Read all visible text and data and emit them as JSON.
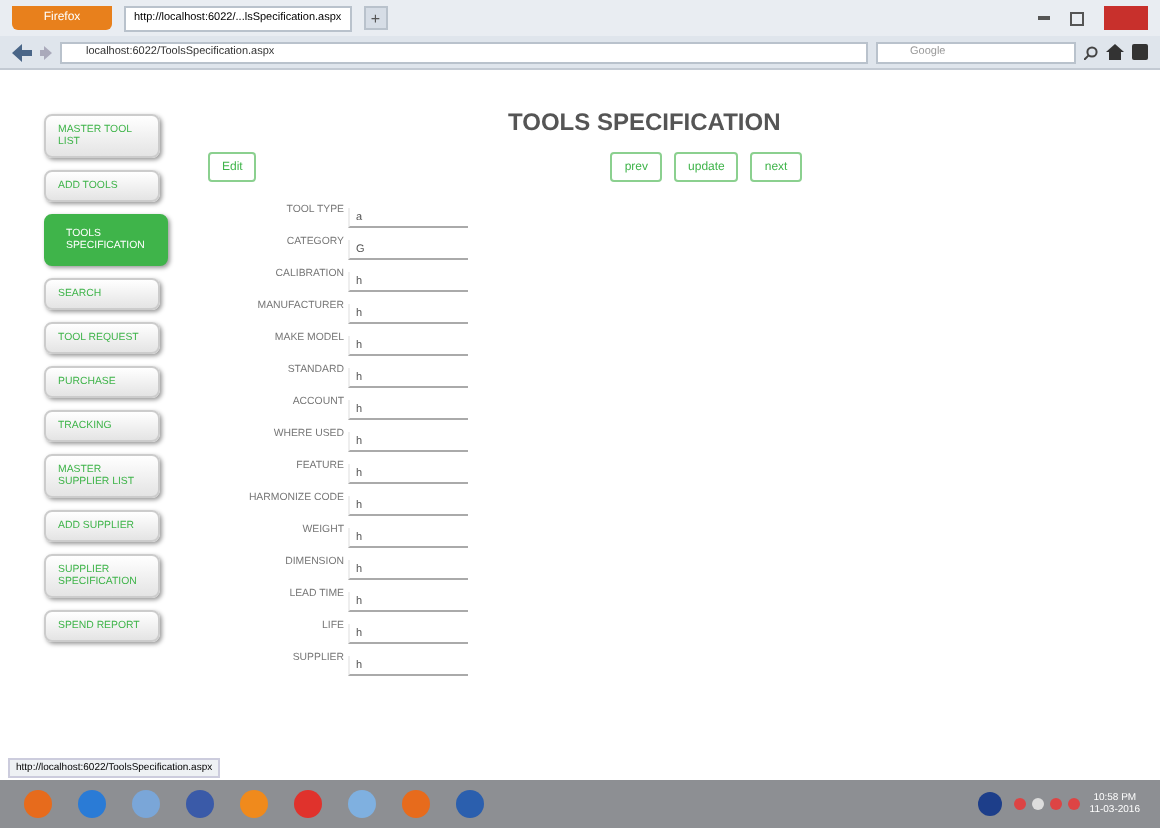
{
  "browser": {
    "menu_button": "Firefox",
    "tab_title": "http://localhost:6022/...lsSpecification.aspx",
    "new_tab": "+",
    "address": "localhost:6022/ToolsSpecification.aspx",
    "search_placeholder": "Google",
    "status_url": "http://localhost:6022/ToolsSpecification.aspx"
  },
  "sidebar": {
    "items": [
      {
        "label": "MASTER TOOL LIST",
        "selected": false
      },
      {
        "label": "ADD TOOLS",
        "selected": false
      },
      {
        "label": "TOOLS SPECIFICATION",
        "selected": true
      },
      {
        "label": "SEARCH",
        "selected": false
      },
      {
        "label": "TOOL REQUEST",
        "selected": false
      },
      {
        "label": "PURCHASE",
        "selected": false
      },
      {
        "label": "TRACKING",
        "selected": false
      },
      {
        "label": "MASTER SUPPLIER LIST",
        "selected": false
      },
      {
        "label": "ADD SUPPLIER",
        "selected": false
      },
      {
        "label": "SUPPLIER SPECIFICATION",
        "selected": false
      },
      {
        "label": "SPEND REPORT",
        "selected": false
      }
    ]
  },
  "page": {
    "title": "TOOLS SPECIFICATION",
    "edit_button": "Edit",
    "nav_buttons": [
      "prev",
      "update",
      "next"
    ]
  },
  "fields": [
    {
      "label": "TOOL TYPE",
      "value": "a"
    },
    {
      "label": "CATEGORY",
      "value": "G"
    },
    {
      "label": "CALIBRATION",
      "value": "h"
    },
    {
      "label": "MANUFACTURER",
      "value": "h"
    },
    {
      "label": "MAKE MODEL",
      "value": "h"
    },
    {
      "label": "STANDARD",
      "value": "h"
    },
    {
      "label": "ACCOUNT",
      "value": "h"
    },
    {
      "label": "WHERE USED",
      "value": "h"
    },
    {
      "label": "FEATURE",
      "value": "h"
    },
    {
      "label": "HARMONIZE CODE",
      "value": "h"
    },
    {
      "label": "WEIGHT",
      "value": "h"
    },
    {
      "label": "DIMENSION",
      "value": "h"
    },
    {
      "label": "LEAD TIME",
      "value": "h"
    },
    {
      "label": "LIFE",
      "value": "h"
    },
    {
      "label": "SUPPLIER",
      "value": "h"
    }
  ],
  "taskbar": {
    "time": "10:58 PM",
    "date": "11-03-2016"
  }
}
